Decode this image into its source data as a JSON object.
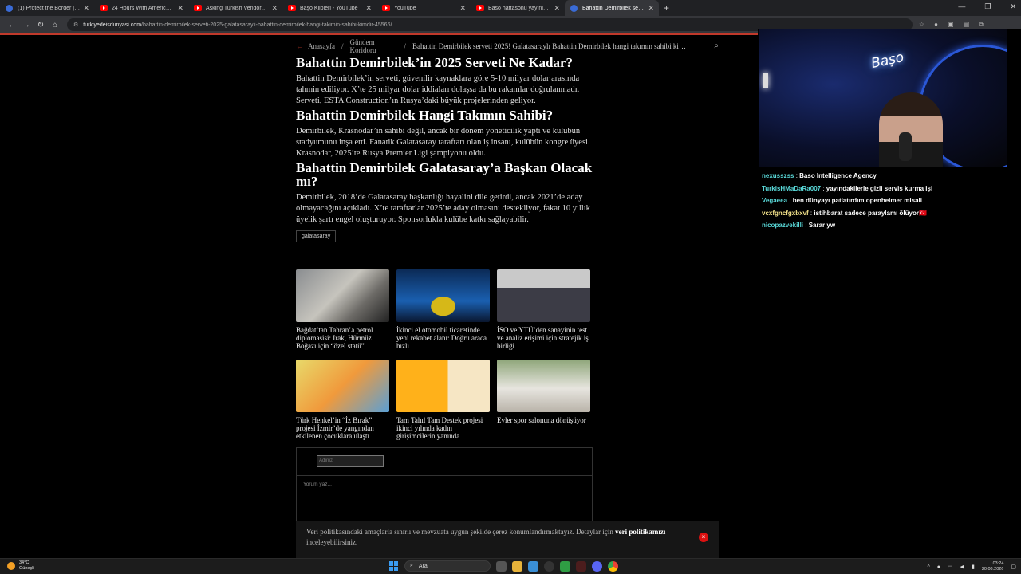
{
  "browser": {
    "tabs": [
      {
        "label": "(1) Protect the Border | Play on",
        "icon": "discord-icon"
      },
      {
        "label": "24 Hours With America's Most",
        "icon": "youtube-icon"
      },
      {
        "label": "Asking Turkish Vendors for a D",
        "icon": "youtube-icon"
      },
      {
        "label": "Başo Klipleri - YouTube",
        "icon": "youtube-icon"
      },
      {
        "label": "YouTube",
        "icon": "youtube-icon"
      },
      {
        "label": "Baso haftasonu yayınları komik",
        "icon": "youtube-icon"
      },
      {
        "label": "Bahattin Demirbilek serveti 202",
        "icon": "site-icon"
      }
    ],
    "url_host": "turkiyedeisdunyasi.com",
    "url_path": "/bahattin-demirbilek-serveti-2025-galatasarayli-bahattin-demirbilek-hangi-takimin-sahibi-kimdir-45566/"
  },
  "breadcrumb": {
    "home": "Anasayfa",
    "category": "Gündem Koridoru",
    "current": "Bahattin Demirbilek serveti 2025! Galatasaraylı Bahattin Demirbilek hangi takımın sahibi kimdir?"
  },
  "article": {
    "sections": [
      {
        "heading": "Bahattin Demirbilek’in 2025 Serveti Ne Kadar?",
        "body": "Bahattin Demirbilek’in serveti, güvenilir kaynaklara göre 5-10 milyar dolar arasında tahmin ediliyor. X’te 25 milyar dolar iddiaları dolaşsa da bu rakamlar doğrulanmadı. Serveti, ESTA Construction’ın Rusya’daki büyük projelerinden geliyor."
      },
      {
        "heading": "Bahattin Demirbilek Hangi Takımın Sahibi?",
        "body": "Demirbilek, Krasnodar’ın sahibi değil, ancak bir dönem yöneticilik yaptı ve kulübün stadyumunu inşa etti. Fanatik Galatasaray taraftarı olan iş insanı, kulübün kongre üyesi. Krasnodar, 2025’te Rusya Premier Ligi şampiyonu oldu."
      },
      {
        "heading": "Bahattin Demirbilek Galatasaray’a Başkan Olacak mı?",
        "body": "Demirbilek, 2018’de Galatasaray başkanlığı hayalini dile getirdi, ancak 2021’de aday olmayacağını açıkladı. X’te taraftarlar 2025’te aday olmasını destekliyor, fakat 10 yıllık üyelik şartı engel oluşturuyor. Sponsorlukla kulübe katkı sağlayabilir."
      }
    ],
    "tag": "galatasaray"
  },
  "related": [
    {
      "title": "Bağdat’tan Tahran’a petrol diplomasisi: Irak, Hürmüz Boğazı için “özel statü”",
      "thumb": "t1"
    },
    {
      "title": "İkinci el otomobil ticaretinde yeni rekabet alanı: Doğru araca hızlı",
      "thumb": "t2"
    },
    {
      "title": "İSO ve YTÜ’den sanayinin test ve analiz erişimi için stratejik iş birliği",
      "thumb": "t3"
    },
    {
      "title": "Türk Henkel’in “İz Bırak” projesi İzmir’de yangından etkilenen çocuklara ulaştı",
      "thumb": "t4"
    },
    {
      "title": "Tam Tahıl Tam Destek projesi ikinci yılında kadın girişimcilerin yanında",
      "thumb": "t5"
    },
    {
      "title": "Evler spor salonuna dönüşüyor",
      "thumb": "t6"
    }
  ],
  "comment_form": {
    "name_placeholder": "Adınız",
    "comment_placeholder": "Yorum yaz..."
  },
  "cookie_banner": {
    "text_before": "Veri politikasındaki amaçlarla sınırlı ve mevzuata uygun şekilde çerez konumlandırmaktayız. Detaylar için ",
    "link": "veri politikamızı",
    "text_after": " inceleyebilirsiniz.",
    "close": "×"
  },
  "stream": {
    "sign_text": "Başo",
    "chat": [
      {
        "user": "nexusszss",
        "color": "#59d8d8",
        "text": "Baso Intelligence Agency"
      },
      {
        "user": "TurkisHMaDaRa007",
        "color": "#59d8d8",
        "text": "yayındakilerle gizli servis kurma işi"
      },
      {
        "user": "Vegaeea",
        "color": "#59d8d8",
        "text": "ben dünyayı patlatırdım openheimer misali"
      },
      {
        "user": "vcxfgncfgxbxvf",
        "color": "#f3e28a",
        "text": "istihbarat sadece paraylamı ölüyor🇹🇷"
      },
      {
        "user": "nicopazvekilli",
        "color": "#59d8d8",
        "text": "Sarar yw"
      }
    ]
  },
  "taskbar": {
    "temp": "34°C",
    "condition": "Güneşli",
    "search": "Ara",
    "time": "03:24",
    "date": "20.08.2026"
  }
}
